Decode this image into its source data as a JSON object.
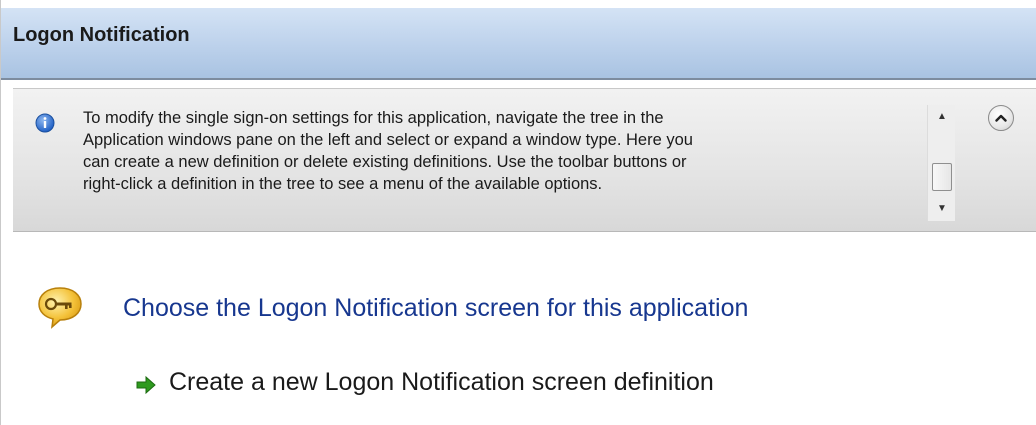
{
  "header": {
    "title": "Logon Notification"
  },
  "info": {
    "icon": "info-icon",
    "lines": [
      "To modify the single sign-on settings for this application, navigate the tree in the",
      "Application windows pane on the left and select or expand a window type. Here you",
      "can create a new definition or delete existing definitions. Use the toolbar buttons or",
      "right-click a definition in the tree to see a menu of the available options."
    ],
    "scroll_up_glyph": "▲",
    "scroll_down_glyph": "▼"
  },
  "task": {
    "icon": "key-speech-bubble-icon",
    "title": "Choose the Logon Notification screen for this application",
    "link_icon": "green-arrow-icon",
    "link_label": "Create a new Logon Notification screen definition"
  },
  "colors": {
    "header_gradient_top": "#d4e3f5",
    "header_gradient_bottom": "#a9c3e2",
    "task_title": "#17378f",
    "arrow_green": "#2e9a1e",
    "key_icon_yellow": "#f4c23a"
  }
}
